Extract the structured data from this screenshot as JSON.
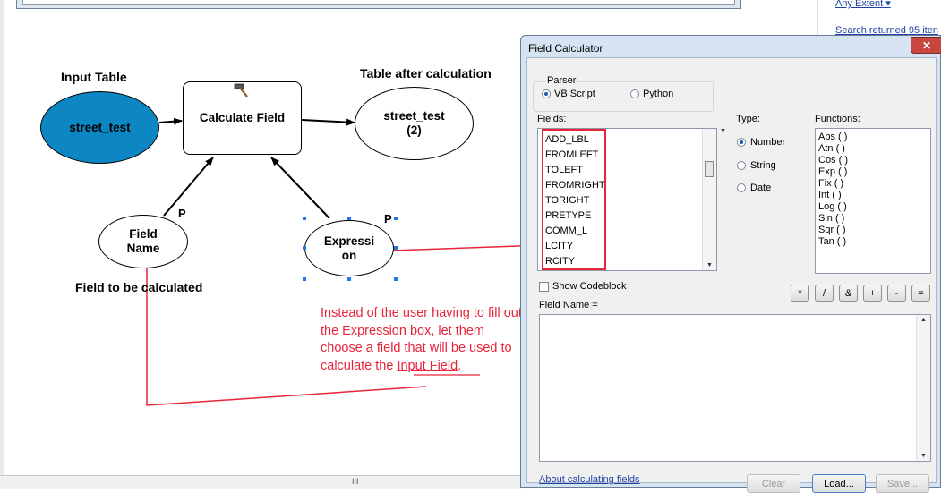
{
  "background": {
    "right_panel": {
      "extent_link": "Any Extent",
      "search_result_link": "Search returned 95 iten"
    },
    "bottom_scroll_thumb": "III"
  },
  "model": {
    "labels": {
      "input_table": "Input Table",
      "table_after": "Table after calculation",
      "field_to_calc": "Field to be calculated"
    },
    "nodes": {
      "street_test": "street_test",
      "calculate_field": "Calculate Field",
      "street_test_2_line1": "street_test",
      "street_test_2_line2": "(2)",
      "field_name_line1": "Field",
      "field_name_line2": "Name",
      "expression_line1": "Expressi",
      "expression_line2": "on"
    },
    "parameter_markers": {
      "field_name": "P",
      "expression": "P"
    },
    "annotation": {
      "text_before": "Instead of the user having to fill out the Expression box, let them choose a field that will be used to calculate the ",
      "text_link": "Input Field",
      "text_after": "."
    },
    "colors": {
      "input_fill": "#0c87c4",
      "annotation_red": "#e8243a"
    }
  },
  "dialog": {
    "title": "Field Calculator",
    "close_label": "✕",
    "parser": {
      "label": "Parser",
      "options": [
        "VB Script",
        "Python"
      ],
      "selected": "VB Script"
    },
    "fields": {
      "label": "Fields:",
      "items": [
        "ADD_LBL",
        "FROMLEFT",
        "TOLEFT",
        "FROMRIGHT",
        "TORIGHT",
        "PRETYPE",
        "COMM_L",
        "LCITY",
        "RCITY"
      ]
    },
    "type": {
      "label": "Type:",
      "options": [
        "Number",
        "String",
        "Date"
      ],
      "selected": "Number"
    },
    "functions": {
      "label": "Functions:",
      "items": [
        "Abs ( )",
        "Atn ( )",
        "Cos ( )",
        "Exp ( )",
        "Fix ( )",
        "Int ( )",
        "Log ( )",
        "Sin ( )",
        "Sqr ( )",
        "Tan ( )"
      ]
    },
    "show_codeblock": "Show Codeblock",
    "operators": [
      "*",
      "/",
      "&",
      "+",
      "-",
      "="
    ],
    "expression_label": "Field Name =",
    "about_link": "About calculating fields",
    "buttons": {
      "clear": "Clear",
      "load": "Load...",
      "save": "Save..."
    }
  }
}
